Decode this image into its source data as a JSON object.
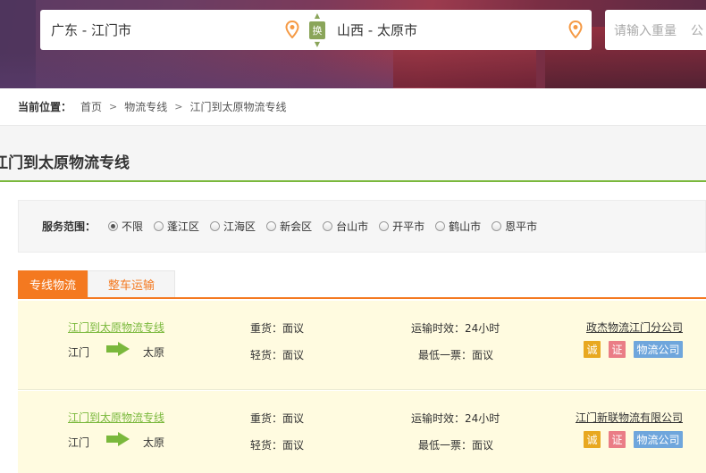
{
  "search": {
    "from_value": "广东 - 江门市",
    "to_value": "山西 - 太原市",
    "swap_label": "换",
    "weight_placeholder": "请输入重量",
    "weight_unit_partial": "公"
  },
  "breadcrumb": {
    "label": "当前位置：",
    "items": [
      "首页",
      "物流专线",
      "江门到太原物流专线"
    ],
    "separator": ">"
  },
  "page_title": "江门到太原物流专线",
  "filter": {
    "label": "服务范围：",
    "options": [
      "不限",
      "蓬江区",
      "江海区",
      "新会区",
      "台山市",
      "开平市",
      "鹤山市",
      "恩平市"
    ],
    "selected": "不限"
  },
  "tabs": [
    "专线物流",
    "整车运输"
  ],
  "routes": [
    {
      "title": "江门到太原物流专线",
      "from": "江门",
      "to": "太原",
      "heavy": "重货：面议",
      "light": "轻货：面议",
      "time": "运输时效：24小时",
      "min": "最低一票：面议",
      "company": "政杰物流江门分公司",
      "badges": [
        "诚",
        "证",
        "物流公司"
      ]
    },
    {
      "title": "江门到太原物流专线",
      "from": "江门",
      "to": "太原",
      "heavy": "重货：面议",
      "light": "轻货：面议",
      "time": "运输时效：24小时",
      "min": "最低一票：面议",
      "company": "江门新联物流有限公司",
      "badges": [
        "诚",
        "证",
        "物流公司"
      ]
    }
  ],
  "colors": {
    "accent_orange": "#f47920",
    "accent_green": "#7ab83c",
    "row_bg": "#fffbe0",
    "pin_orange": "#f59a45"
  }
}
